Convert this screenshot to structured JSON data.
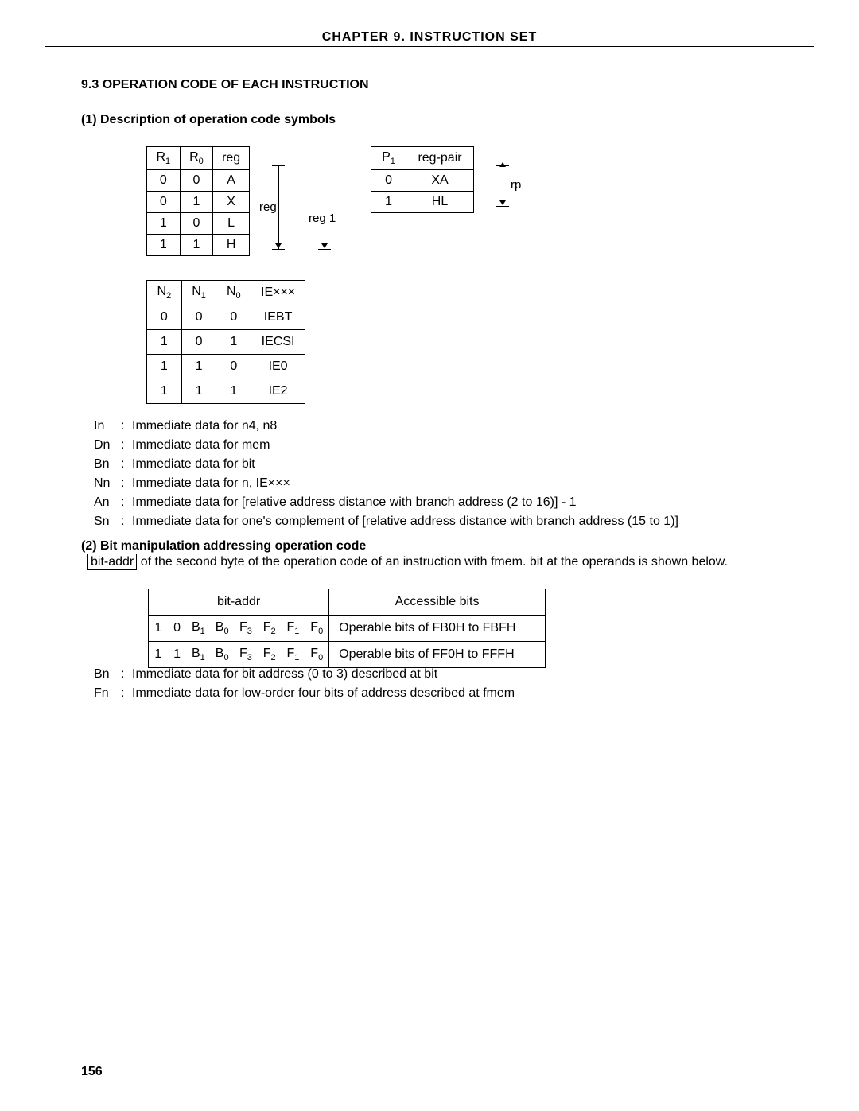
{
  "chapter_header": "CHAPTER  9.  INSTRUCTION  SET",
  "section_9_3": "9.3   OPERATION CODE OF EACH INSTRUCTION",
  "sub_1": "(1)   Description of operation code symbols",
  "reg_table": {
    "h0": "R",
    "h0s": "1",
    "h1": "R",
    "h1s": "0",
    "h2": "reg",
    "rows": [
      [
        "0",
        "0",
        "A"
      ],
      [
        "0",
        "1",
        "X"
      ],
      [
        "1",
        "0",
        "L"
      ],
      [
        "1",
        "1",
        "H"
      ]
    ]
  },
  "reg_bracket_label": "reg",
  "reg1_bracket_label": "reg 1",
  "rp_table": {
    "h0": "P",
    "h0s": "1",
    "h1": "reg-pair",
    "rows": [
      [
        "0",
        "XA"
      ],
      [
        "1",
        "HL"
      ]
    ]
  },
  "rp_bracket_label": "rp",
  "ie_table": {
    "h0": "N",
    "h0s": "2",
    "h1": "N",
    "h1s": "1",
    "h2": "N",
    "h2s": "0",
    "h3": "IE×××",
    "rows": [
      [
        "0",
        "0",
        "0",
        "IEBT"
      ],
      [
        "1",
        "0",
        "1",
        "IECSI"
      ],
      [
        "1",
        "1",
        "0",
        "IE0"
      ],
      [
        "1",
        "1",
        "1",
        "IE2"
      ]
    ]
  },
  "defs_1": [
    [
      "In",
      "Immediate data for n4, n8"
    ],
    [
      "Dn",
      "Immediate data for mem"
    ],
    [
      "Bn",
      "Immediate data for bit"
    ],
    [
      "Nn",
      "Immediate data for n, IE×××"
    ],
    [
      "An",
      "Immediate data for [relative address distance with branch address (2 to 16)] - 1"
    ],
    [
      "Sn",
      "Immediate data for one's complement of [relative address distance with branch address (15 to 1)]"
    ]
  ],
  "sub_2": "(2)   Bit manipulation addressing operation code",
  "sub_2_boxed": "bit-addr",
  "sub_2_text": "of the second byte of the operation code of an instruction with fmem. bit at the operands is shown below.",
  "bit_table": {
    "h_left": "bit-addr",
    "h_right": "Accessible bits",
    "bit_labels": [
      [
        "",
        "",
        "B",
        "B",
        "F",
        "F",
        "F",
        "F"
      ],
      [
        "",
        "",
        "1",
        "0",
        "3",
        "2",
        "1",
        "0"
      ]
    ],
    "rows": [
      {
        "bits": [
          "1",
          "0"
        ],
        "desc": "Operable bits of FB0H to FBFH"
      },
      {
        "bits": [
          "1",
          "1"
        ],
        "desc": "Operable bits of FF0H to FFFH"
      }
    ]
  },
  "defs_2": [
    [
      "Bn",
      "Immediate data for bit address (0 to 3) described at bit"
    ],
    [
      "Fn",
      "Immediate data for low-order four bits of address described at fmem"
    ]
  ],
  "page_number": "156"
}
